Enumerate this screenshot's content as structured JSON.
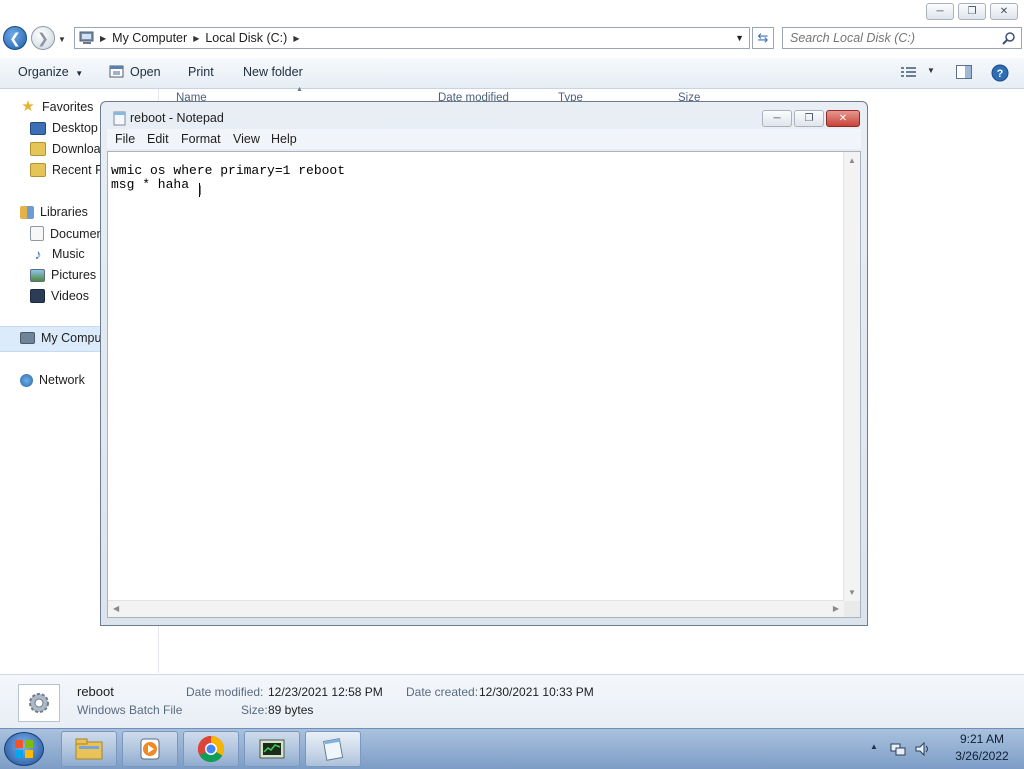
{
  "explorer": {
    "window_buttons": {
      "minimize": "─",
      "maximize": "❐",
      "close": "✕"
    },
    "breadcrumb": [
      "My Computer",
      "Local Disk (C:)"
    ],
    "search": {
      "placeholder": "Search Local Disk (C:)"
    },
    "toolbar": {
      "organize": "Organize",
      "open": "Open",
      "print": "Print",
      "new_folder": "New folder"
    },
    "columns": [
      "Name",
      "Date modified",
      "Type",
      "Size"
    ],
    "nav": {
      "favorites": "Favorites",
      "favorites_items": [
        "Desktop",
        "Downloads",
        "Recent Places"
      ],
      "libraries": "Libraries",
      "libraries_items": [
        "Documents",
        "Music",
        "Pictures",
        "Videos"
      ],
      "computer": "My Computer",
      "network": "Network"
    },
    "details": {
      "name": "reboot",
      "type": "Windows Batch File",
      "date_modified_label": "Date modified:",
      "date_modified": "12/23/2021 12:58 PM",
      "size_label": "Size:",
      "size": "89 bytes",
      "date_created_label": "Date created:",
      "date_created": "12/30/2021 10:33 PM"
    }
  },
  "notepad": {
    "title": "reboot - Notepad",
    "menu": [
      "File",
      "Edit",
      "Format",
      "View",
      "Help"
    ],
    "content": "wmic os where primary=1 reboot\nmsg * haha"
  },
  "taskbar": {
    "apps": [
      "file-explorer",
      "media-player",
      "chrome",
      "task-manager",
      "notepad"
    ],
    "clock": {
      "time": "9:21 AM",
      "date": "3/26/2022"
    }
  },
  "colors": {
    "taskbar": "#8aa8cf",
    "accent": "#1f5fa8",
    "close_button": "#c8433a"
  }
}
